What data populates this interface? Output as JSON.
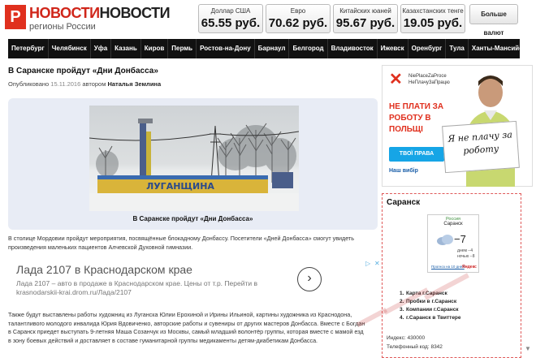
{
  "site": {
    "logo_letter": "Р",
    "logo_main_red": "НОВОСТИ",
    "logo_main_black": "НОВОСТИ",
    "logo_sub": "регионы России"
  },
  "rates": [
    {
      "label": "Доллар США",
      "value": "65.55 руб."
    },
    {
      "label": "Евро",
      "value": "70.62 руб."
    },
    {
      "label": "Китайских юаней",
      "value": "95.67 руб."
    },
    {
      "label": "Казахстанских тенге",
      "value": "19.05 руб."
    }
  ],
  "more_rates_label": "Больше валют",
  "nav": [
    "Петербург",
    "Челябинск",
    "Уфа",
    "Казань",
    "Киров",
    "Пермь",
    "Ростов-на-Дону",
    "Барнаул",
    "Белгород",
    "Владивосток",
    "Ижевск",
    "Оренбург",
    "Тула",
    "Ханты-Мансийск"
  ],
  "article": {
    "title": "В Саранске пройдут «Дни Донбасса»",
    "published_label": "Опубликовано",
    "date": "15.11.2016",
    "author_label": "автором",
    "author": "Наталья Землина",
    "photo_caption": "В Саранске пройдут «Дни Донбасса»",
    "photo_sign": "ЛУГАНЩИНА",
    "paragraph1": "В столице Мордовии пройдут мероприятия, посвящённые блокадному Донбассу. Посетители «Дней Донбасса» смогут увидеть произведения маленьких пациентов Алчевской Духовной гимназии.",
    "paragraph2_line1": "Также будут выставлены работы художниц из Луганска Юлии Ерохиной и Ирины Ильиной, картины художника из Краснодона,",
    "paragraph2_line2": "талантливого молодого инвалида Юрия Вдовиченко, авторские работы и сувениры от других мастеров Донбасса. Вместе с Богдан",
    "paragraph2_line3": "в Саранск приедет выступать 9-летняя Маша Созанчук из Москвы, самый младший волонтёр группы, которая вместе с мамой езд",
    "paragraph2_line4": "в зону боевых действий и доставляет в составе гуманитарной группы медикаменты детям-диабетикам Донбасса."
  },
  "ad_banner": {
    "title": "Лада 2107 в Краснодарском крае",
    "text_main": "Лада 2107 – авто в продаже в Краснодарском крае. Цены от т.р.",
    "text_link": "Перейти в",
    "text_domain": "krasnodarskii-krai.drom.ru/Лада/2107",
    "arrow": "›"
  },
  "side_ad": {
    "site_line1": "NiePlaceZaProce",
    "site_line2": "НеПлачуЗаПрацю",
    "headline": "НЕ ПЛАТИ ЗА РОБОТУ В ПОЛЬЩІ",
    "button": "ТВОЇ ПРАВА",
    "brands": "Наш вибір",
    "sign_text": "Я не плачу за роботу"
  },
  "weather": {
    "city_heading": "Саранск",
    "country": "Россия",
    "city": "Саранск",
    "temp": "−7",
    "day": "днем −4",
    "night": "ночью −8",
    "forecast_link": "Прогноз на 10 дней",
    "brand": "Яндекс"
  },
  "city_links": [
    {
      "num": "1.",
      "label": "Карта г.Саранск"
    },
    {
      "num": "2.",
      "label": "Пробки в г.Саранск"
    },
    {
      "num": "3.",
      "label": "Компании г.Саранск"
    },
    {
      "num": "4.",
      "label": "г.Саранск в Твиттере"
    }
  ],
  "stats": {
    "index_label": "Индекс: 430000",
    "phone_label": "Телефонный код: 8342"
  },
  "colors": {
    "brand_red": "#d0261a",
    "nav_bg": "#111111",
    "ad_blue": "#16a5e6"
  }
}
